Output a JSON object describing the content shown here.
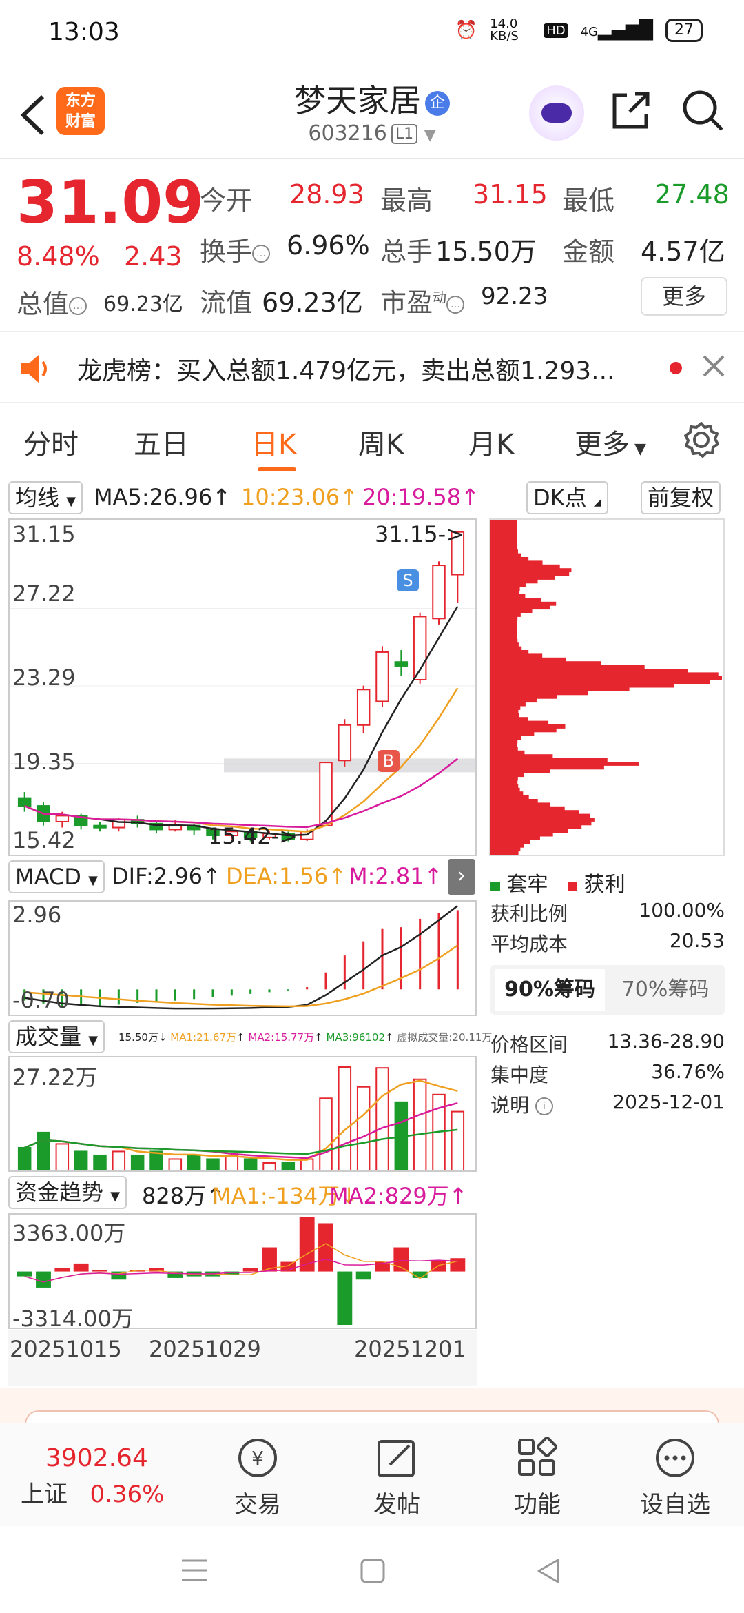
{
  "status_bar": {
    "time": "13:03",
    "net_speed": "14.0 KB/S",
    "hd": "HD",
    "signal": "4G",
    "battery": "27"
  },
  "header": {
    "logo_line1": "东方",
    "logo_line2": "财富",
    "stock_name": "梦天家居",
    "badge": "企",
    "stock_code": "603216",
    "level": "L1"
  },
  "quote": {
    "price": "31.09",
    "pct_change": "8.48%",
    "change": "2.43",
    "open_label": "今开",
    "open": "28.93",
    "high_label": "最高",
    "high": "31.15",
    "low_label": "最低",
    "low": "27.48",
    "turnover_label": "换手",
    "turnover": "6.96%",
    "volume_label": "总手",
    "volume": "15.50万",
    "amount_label": "金额",
    "amount": "4.57亿",
    "total_cap_label": "总值",
    "total_cap": "69.23亿",
    "float_cap_label": "流值",
    "float_cap": "69.23亿",
    "pe_label": "市盈",
    "pe_sup": "动",
    "pe": "92.23",
    "more": "更多"
  },
  "news": {
    "text": "龙虎榜：买入总额1.479亿元，卖出总额1.293..."
  },
  "tabs": [
    "分时",
    "五日",
    "日K",
    "周K",
    "月K",
    "更多"
  ],
  "active_tab": "日K",
  "kline": {
    "indicator": "均线",
    "ma5": "MA5:26.96",
    "ma10": "10:23.06",
    "ma20": "20:19.58",
    "dk_button": "DK点",
    "adjust_button": "前复权",
    "y_labels": [
      "31.15",
      "27.22",
      "23.29",
      "19.35",
      "15.42"
    ],
    "high_marker": "31.15->",
    "low_marker": "15.42->",
    "sell_marker": "S",
    "buy_marker": "B"
  },
  "macd": {
    "name": "MACD",
    "dif": "DIF:2.96",
    "dea": "DEA:1.56",
    "m": "M:2.81",
    "y_top": "2.96",
    "y_bottom": "-0.70"
  },
  "volume": {
    "name": "成交量",
    "vals": "15.50万",
    "ma1": "MA1:21.67万",
    "ma2": "MA2:15.77万",
    "ma3": "MA3:96102",
    "virtual": "虚拟成交量:20.11万",
    "y_top": "27.22万"
  },
  "fund": {
    "name": "资金趋势",
    "value": "828万",
    "ma1": "MA1:-134万",
    "ma2": "MA2:829万",
    "y_top": "3363.00万",
    "y_bottom": "-3314.00万"
  },
  "dates": [
    "20251015",
    "20251029",
    "20251201"
  ],
  "chips": {
    "legend_trapped": "套牢",
    "legend_profit": "获利",
    "profit_ratio_label": "获利比例",
    "profit_ratio": "100.00%",
    "avg_cost_label": "平均成本",
    "avg_cost": "20.53",
    "tab90": "90%筹码",
    "tab70": "70%筹码",
    "range_label": "价格区间",
    "range": "13.36-28.90",
    "concentration_label": "集中度",
    "concentration": "36.76%",
    "note_label": "说明",
    "date": "2025-12-01"
  },
  "bottom_nav": {
    "index_value": "3902.64",
    "index_name": "上证",
    "index_pct": "0.36%",
    "items": [
      "交易",
      "发帖",
      "功能",
      "设自选"
    ]
  },
  "chart_data": [
    {
      "type": "candlestick",
      "title": "日K",
      "ylim": [
        15.42,
        31.15
      ],
      "note": "approximate daily candles, Oct–Dec 2025",
      "candles": [
        {
          "o": 17.6,
          "c": 17.2,
          "h": 17.9,
          "l": 16.9
        },
        {
          "o": 17.2,
          "c": 16.4,
          "h": 17.4,
          "l": 16.2
        },
        {
          "o": 16.4,
          "c": 16.7,
          "h": 16.9,
          "l": 16.1
        },
        {
          "o": 16.7,
          "c": 16.2,
          "h": 16.8,
          "l": 16.0
        },
        {
          "o": 16.2,
          "c": 16.1,
          "h": 16.4,
          "l": 15.9
        },
        {
          "o": 16.1,
          "c": 16.5,
          "h": 16.6,
          "l": 15.9
        },
        {
          "o": 16.5,
          "c": 16.3,
          "h": 16.7,
          "l": 16.1
        },
        {
          "o": 16.3,
          "c": 16.0,
          "h": 16.4,
          "l": 15.8
        },
        {
          "o": 16.0,
          "c": 16.2,
          "h": 16.5,
          "l": 15.9
        },
        {
          "o": 16.2,
          "c": 16.0,
          "h": 16.3,
          "l": 15.7
        },
        {
          "o": 16.0,
          "c": 15.7,
          "h": 16.1,
          "l": 15.5
        },
        {
          "o": 15.7,
          "c": 15.9,
          "h": 16.0,
          "l": 15.5
        },
        {
          "o": 15.9,
          "c": 15.6,
          "h": 16.0,
          "l": 15.4
        },
        {
          "o": 15.6,
          "c": 15.8,
          "h": 15.9,
          "l": 15.5
        },
        {
          "o": 15.8,
          "c": 15.5,
          "h": 15.9,
          "l": 15.4
        },
        {
          "o": 15.5,
          "c": 15.9,
          "h": 16.0,
          "l": 15.42
        },
        {
          "o": 16.2,
          "c": 19.4,
          "h": 19.4,
          "l": 16.2
        },
        {
          "o": 19.5,
          "c": 21.3,
          "h": 21.6,
          "l": 19.2
        },
        {
          "o": 21.3,
          "c": 23.1,
          "h": 23.3,
          "l": 20.9
        },
        {
          "o": 22.5,
          "c": 25.0,
          "h": 25.3,
          "l": 22.2
        },
        {
          "o": 24.5,
          "c": 24.3,
          "h": 25.1,
          "l": 23.8
        },
        {
          "o": 23.6,
          "c": 26.8,
          "h": 27.0,
          "l": 23.4
        },
        {
          "o": 26.7,
          "c": 29.4,
          "h": 29.6,
          "l": 26.4
        },
        {
          "o": 28.93,
          "c": 31.09,
          "h": 31.15,
          "l": 27.48
        }
      ],
      "ma5": 26.96,
      "ma10": 23.06,
      "ma20": 19.58
    },
    {
      "type": "line",
      "title": "MACD",
      "series": [
        {
          "name": "DIF",
          "values": [
            -0.3,
            -0.4,
            -0.5,
            -0.55,
            -0.6,
            -0.62,
            -0.64,
            -0.66,
            -0.68,
            -0.68,
            -0.68,
            -0.67,
            -0.66,
            -0.64,
            -0.62,
            -0.55,
            -0.2,
            0.25,
            0.7,
            1.2,
            1.5,
            1.95,
            2.45,
            2.96
          ]
        },
        {
          "name": "DEA",
          "values": [
            -0.1,
            -0.15,
            -0.2,
            -0.25,
            -0.3,
            -0.35,
            -0.4,
            -0.44,
            -0.48,
            -0.51,
            -0.54,
            -0.56,
            -0.58,
            -0.59,
            -0.6,
            -0.59,
            -0.5,
            -0.35,
            -0.15,
            0.12,
            0.4,
            0.7,
            1.1,
            1.56
          ]
        }
      ],
      "ylim": [
        -0.7,
        2.96
      ]
    },
    {
      "type": "bar",
      "title": "成交量",
      "unit": "万",
      "values": [
        6,
        10,
        7,
        5,
        4,
        5,
        4,
        5,
        3,
        4,
        3,
        4,
        3,
        2,
        2,
        3,
        19,
        27.22,
        22,
        27,
        18,
        24,
        20,
        15.5
      ],
      "ylim": [
        0,
        27.22
      ]
    },
    {
      "type": "bar",
      "title": "资金趋势",
      "unit": "万",
      "values": [
        -300,
        -1000,
        200,
        500,
        100,
        -500,
        100,
        200,
        -400,
        -300,
        -300,
        -200,
        200,
        1500,
        600,
        3363,
        3000,
        -3314,
        -500,
        600,
        1500,
        -400,
        700,
        828
      ],
      "ylim": [
        -3314,
        3363
      ]
    },
    {
      "type": "bar",
      "title": "筹码分布",
      "orientation": "horizontal",
      "price_range": [
        13.36,
        28.9
      ],
      "profit_ratio": 100.0,
      "avg_cost": 20.53
    }
  ]
}
